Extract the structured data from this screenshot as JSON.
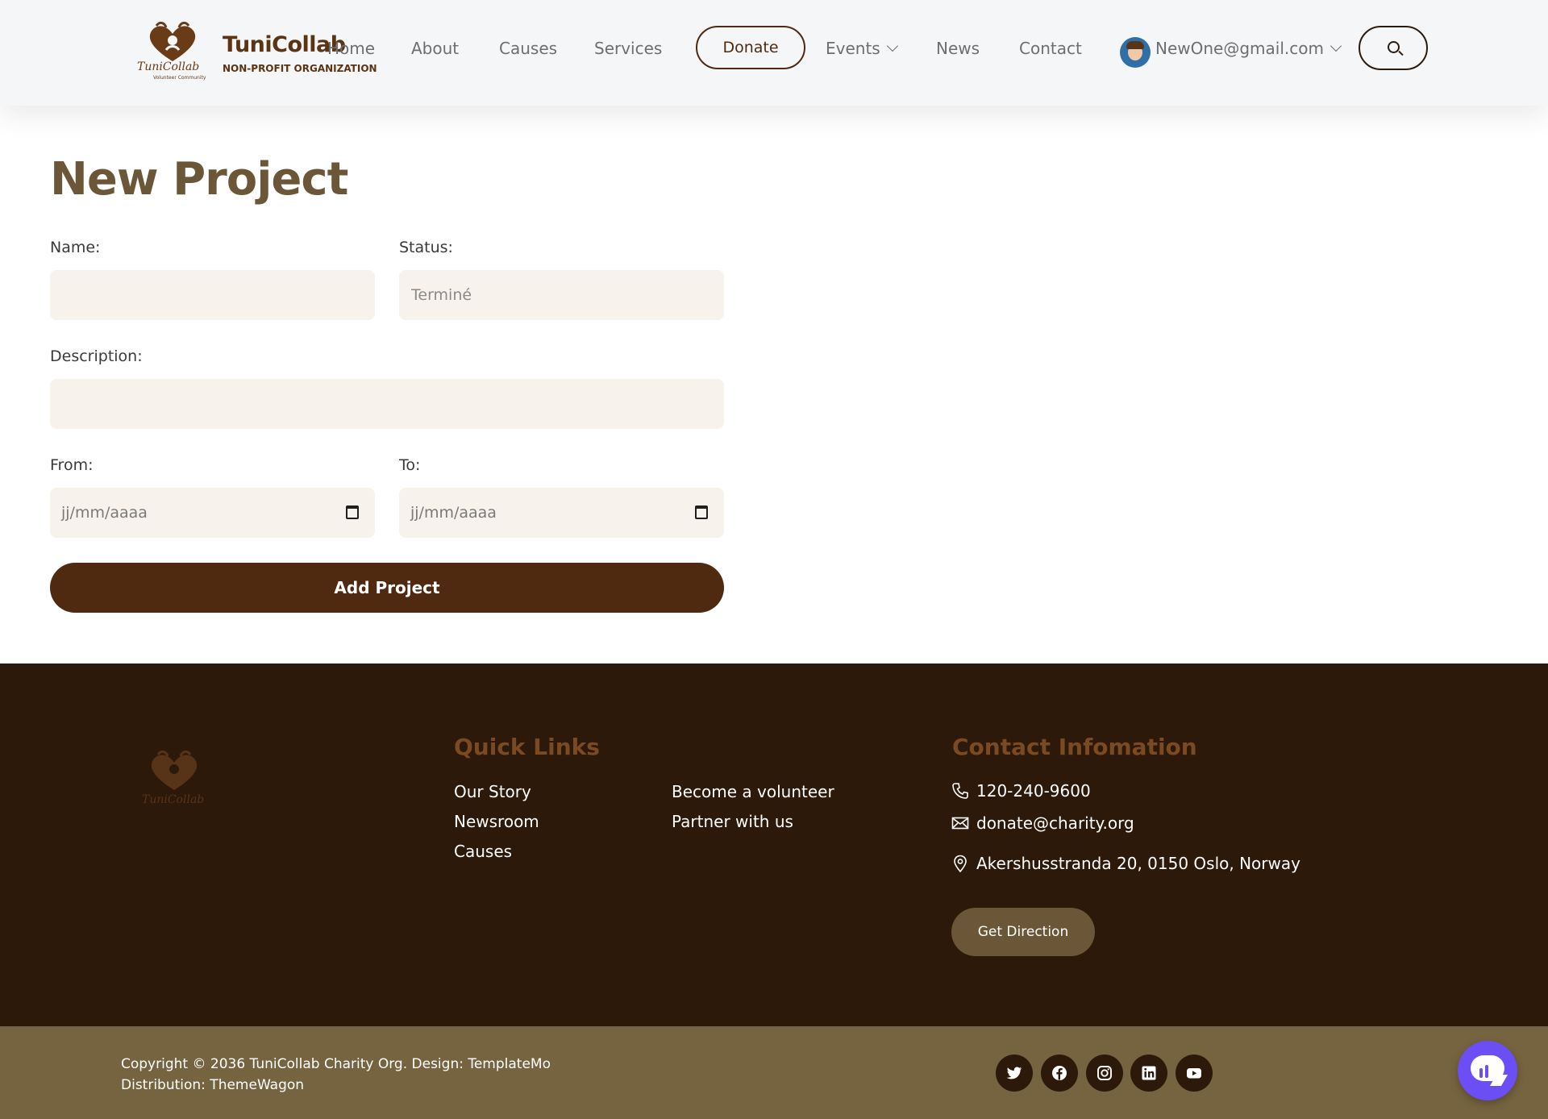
{
  "header": {
    "logo": {
      "icon": "heart-hands-logo",
      "script_text": "TuniCollab",
      "subtext": "Volunteer Community"
    },
    "brand_name": "TuniCollab",
    "brand_tagline": "NON-PROFIT ORGANIZATION",
    "nav": [
      {
        "label": "Home"
      },
      {
        "label": "About"
      },
      {
        "label": "Causes"
      },
      {
        "label": "Services"
      },
      {
        "label": "Donate"
      },
      {
        "label": "Events"
      },
      {
        "label": "News"
      },
      {
        "label": "Contact"
      }
    ],
    "user_email": "NewOne@gmail.com",
    "search_icon": "search-icon"
  },
  "form": {
    "title": "New Project",
    "name_label": "Name:",
    "name_value": "",
    "status_label": "Status:",
    "status_placeholder": "Terminé",
    "description_label": "Description:",
    "description_value": "",
    "from_label": "From:",
    "from_placeholder": "jj/mm/aaaa",
    "to_label": "To:",
    "to_placeholder": "jj/mm/aaaa",
    "submit_label": "Add Project"
  },
  "footer": {
    "quick_links_heading": "Quick Links",
    "links_col1": [
      "Our Story",
      "Newsroom",
      "Causes"
    ],
    "links_col2": [
      "Become a volunteer",
      "Partner with us"
    ],
    "contact_heading": "Contact Infomation",
    "phone": "120-240-9600",
    "email": "donate@charity.org",
    "address": "Akershusstranda 20, 0150 Oslo, Norway",
    "direction_label": "Get Direction",
    "copyright_line1": "Copyright © 2036 TuniCollab Charity Org. Design: TemplateMo",
    "copyright_line2": "Distribution: ThemeWagon",
    "social": [
      "twitter-icon",
      "facebook-icon",
      "instagram-icon",
      "linkedin-icon",
      "youtube-icon"
    ]
  },
  "colors": {
    "brand_brown": "#4f2a10",
    "footer_bg": "#2d190a",
    "bottom_bar": "#766440",
    "title_color": "#6b5738",
    "chat_accent": "#6b4ff5"
  }
}
